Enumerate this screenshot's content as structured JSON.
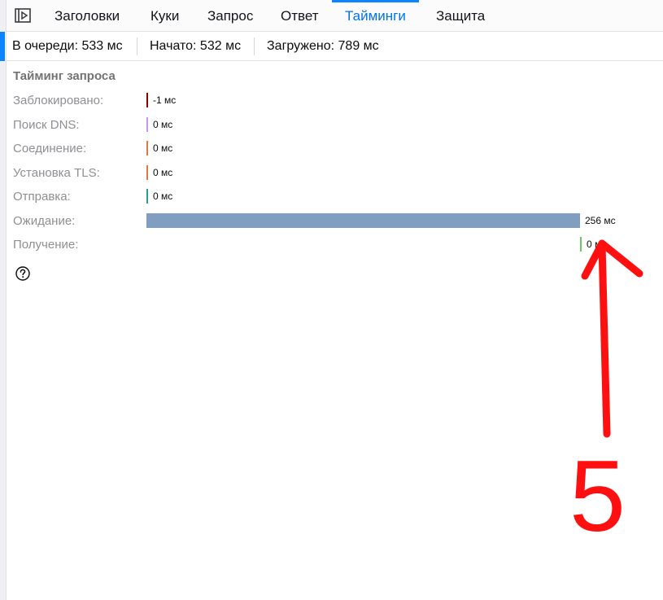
{
  "tabs": [
    {
      "label": "Заголовки"
    },
    {
      "label": "Куки"
    },
    {
      "label": "Запрос"
    },
    {
      "label": "Ответ"
    },
    {
      "label": "Тайминги",
      "active": true
    },
    {
      "label": "Защита"
    }
  ],
  "summary": {
    "queued": "В очереди: 533 мс",
    "started": "Начато: 532 мс",
    "downloaded": "Загружено: 789 мс"
  },
  "timings": {
    "title": "Тайминг запроса",
    "rows": [
      {
        "label": "Заблокировано:",
        "value": "-1 мс",
        "ms": -1,
        "color": "#8b0000"
      },
      {
        "label": "Поиск DNS:",
        "value": "0 мс",
        "ms": 0,
        "color": "#c597f0"
      },
      {
        "label": "Соединение:",
        "value": "0 мс",
        "ms": 0,
        "color": "#e5773e"
      },
      {
        "label": "Установка TLS:",
        "value": "0 мс",
        "ms": 0,
        "color": "#e5773e"
      },
      {
        "label": "Отправка:",
        "value": "0 мс",
        "ms": 0,
        "color": "#2a9b9b"
      },
      {
        "label": "Ожидание:",
        "value": "256 мс",
        "ms": 256,
        "color": "#809fc0"
      },
      {
        "label": "Получение:",
        "value": "0 мс",
        "ms": 0,
        "color": "#74c46a"
      }
    ]
  },
  "annotation": {
    "number": "5",
    "color": "#ff1010"
  },
  "icons": {
    "panel_toggle": "sidebar-toggle-icon",
    "help": "help-icon"
  }
}
